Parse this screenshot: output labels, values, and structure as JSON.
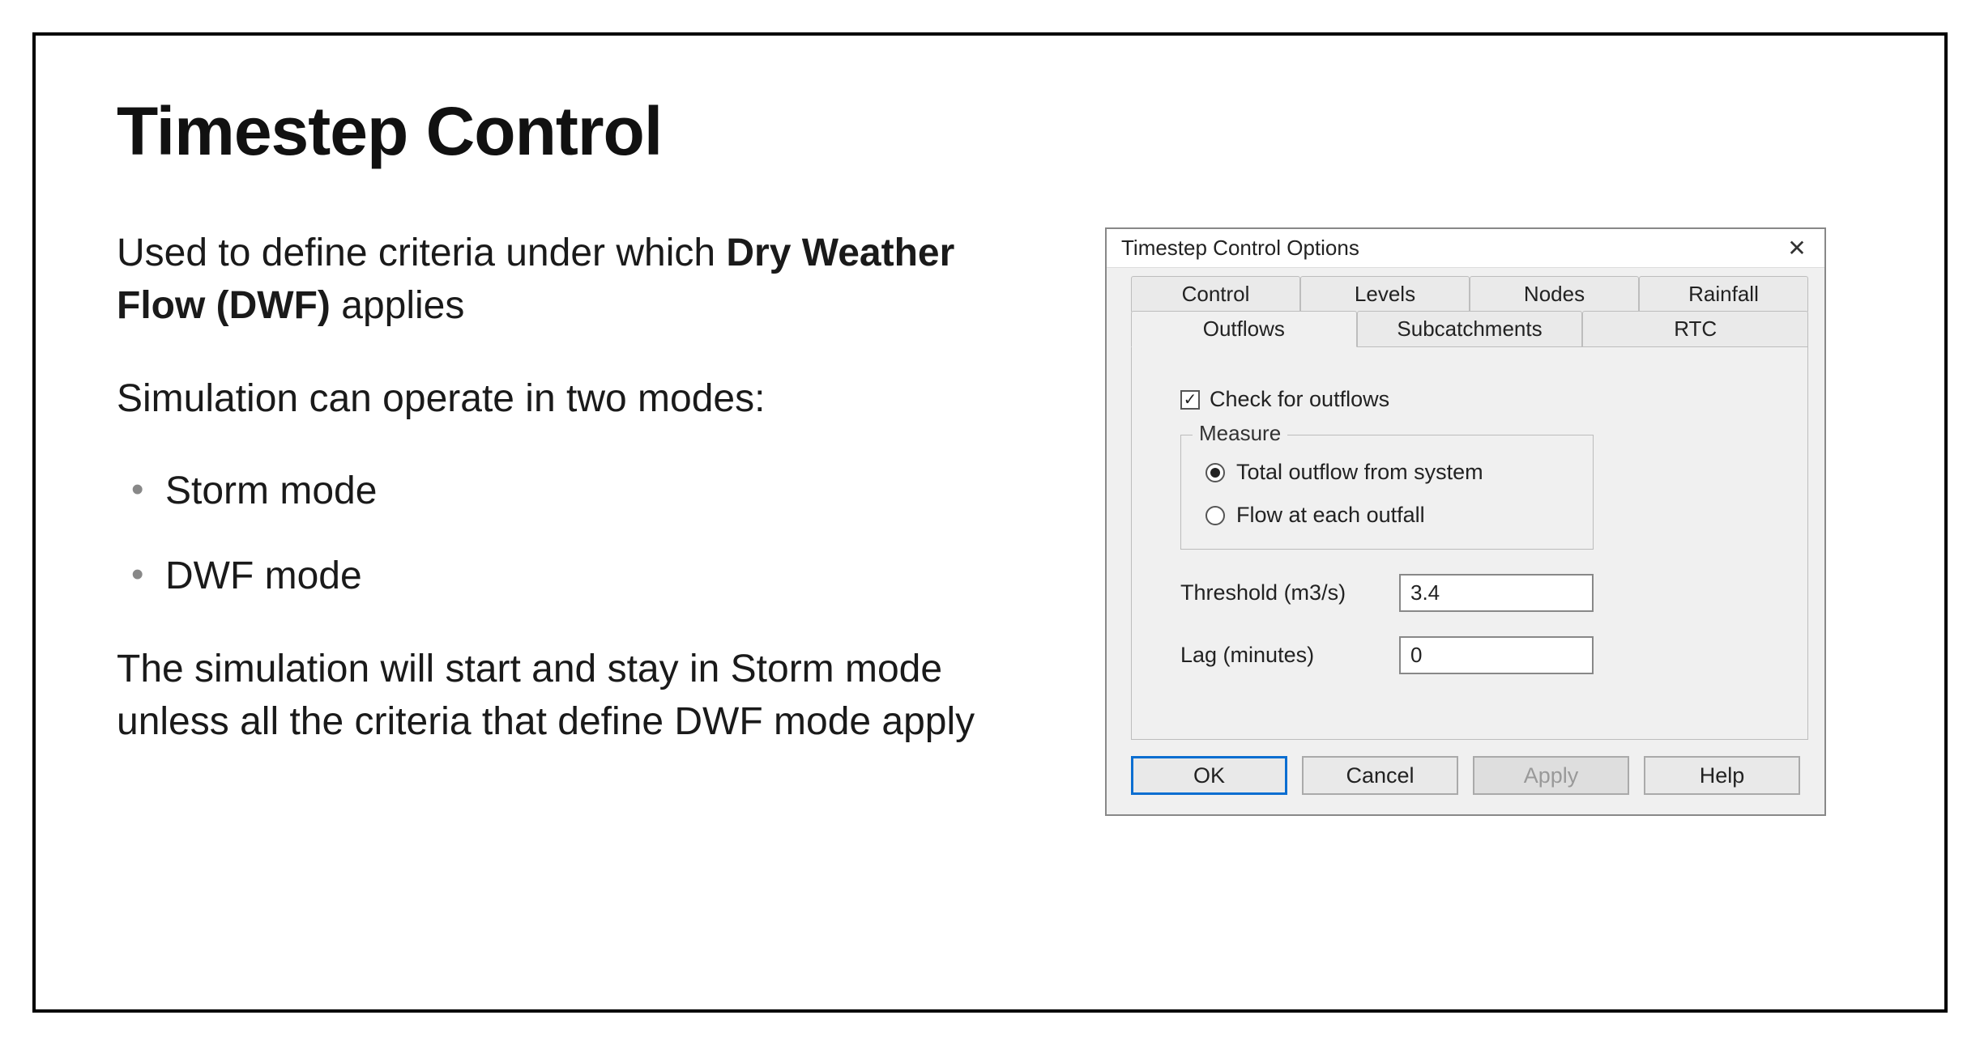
{
  "slide": {
    "title": "Timestep Control",
    "para1_a": "Used to define criteria under which ",
    "para1_strong": "Dry Weather Flow (DWF)",
    "para1_b": " applies",
    "para2": "Simulation can operate in two modes:",
    "bullets": [
      "Storm mode",
      "DWF mode"
    ],
    "para3": "The simulation will start and stay in Storm mode unless all the criteria that define DWF mode apply"
  },
  "dialog": {
    "title": "Timestep Control Options",
    "tabs_row1": [
      "Control",
      "Levels",
      "Nodes",
      "Rainfall"
    ],
    "tabs_row2": [
      "Outflows",
      "Subcatchments",
      "RTC"
    ],
    "active_tab": "Outflows",
    "checkbox_label": "Check for outflows",
    "checkbox_checked": true,
    "measure": {
      "legend": "Measure",
      "opt1": "Total outflow from system",
      "opt2": "Flow at each outfall",
      "selected": "opt1"
    },
    "threshold_label": "Threshold (m3/s)",
    "threshold_value": "3.4",
    "lag_label": "Lag (minutes)",
    "lag_value": "0",
    "buttons": {
      "ok": "OK",
      "cancel": "Cancel",
      "apply": "Apply",
      "help": "Help"
    }
  }
}
